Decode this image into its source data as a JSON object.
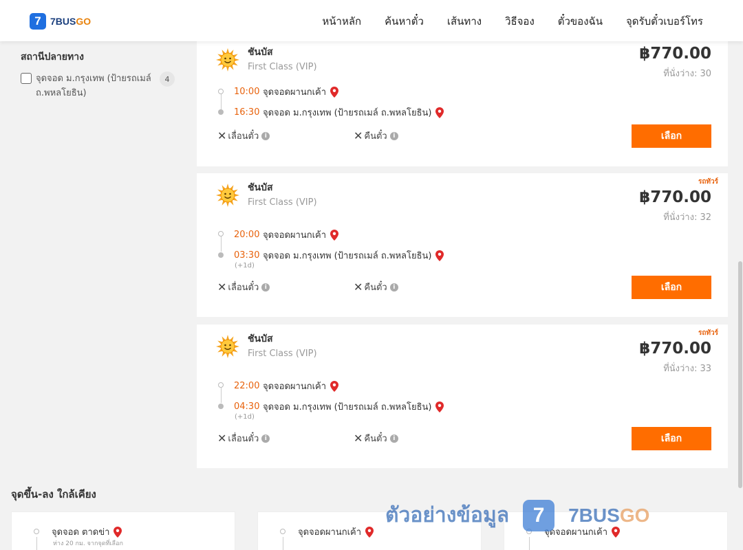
{
  "header": {
    "logo_icon": "7",
    "logo_text": "7BUS",
    "logo_text_go": "GO",
    "nav": [
      "หน้าหลัก",
      "ค้นหาตั๋ว",
      "เส้นทาง",
      "วิธีจอง",
      "ตั๋วของฉัน",
      "จุดรับตั๋วเบอร์โทร"
    ]
  },
  "sidebar": {
    "title": "สถานีปลายทาง",
    "filter_label": "จุดจอด ม.กรุงเทพ (ป้ายรถเมล์ ถ.พหลโยธิน)",
    "filter_count": "4"
  },
  "trips": [
    {
      "operator": "ชันบัส",
      "class": "First Class (VIP)",
      "price": "฿770.00",
      "seats": "ที่นั่งว่าง: 30",
      "promo": "",
      "depart_time": "10:00",
      "depart_place": "จุดจอดผานกเค้า",
      "arrive_time": "16:30",
      "arrive_place": "จุดจอด ม.กรุงเทพ (ป้ายรถเมล์ ถ.พหลโยธิน)",
      "next_day": "",
      "reschedule": "เลื่อนตั๋ว",
      "refund": "คืนตั๋ว",
      "button": "เลือก"
    },
    {
      "operator": "ชันบัส",
      "class": "First Class (VIP)",
      "price": "฿770.00",
      "seats": "ที่นั่งว่าง: 32",
      "promo": "รถทัวร์",
      "depart_time": "20:00",
      "depart_place": "จุดจอดผานกเค้า",
      "arrive_time": "03:30",
      "arrive_place": "จุดจอด ม.กรุงเทพ (ป้ายรถเมล์ ถ.พหลโยธิน)",
      "next_day": "(+1d)",
      "reschedule": "เลื่อนตั๋ว",
      "refund": "คืนตั๋ว",
      "button": "เลือก"
    },
    {
      "operator": "ชันบัส",
      "class": "First Class (VIP)",
      "price": "฿770.00",
      "seats": "ที่นั่งว่าง: 33",
      "promo": "รถทัวร์",
      "depart_time": "22:00",
      "depart_place": "จุดจอดผานกเค้า",
      "arrive_time": "04:30",
      "arrive_place": "จุดจอด ม.กรุงเทพ (ป้ายรถเมล์ ถ.พหลโยธิน)",
      "next_day": "(+1d)",
      "reschedule": "เลื่อนตั๋ว",
      "refund": "คืนตั๋ว",
      "button": "เลือก"
    }
  ],
  "nearby": {
    "title": "จุดขึ้น-ลง ใกล้เคียง",
    "cards": [
      {
        "stop": "จุดจอด ตาดข่า",
        "sub": "ห่าง 20 กม. จากจุดที่เลือก"
      },
      {
        "stop": "จุดจอดผานกเค้า",
        "sub": ""
      },
      {
        "stop": "จุดจอดผานกเค้า",
        "sub": ""
      }
    ]
  },
  "watermark": {
    "text": "ตัวอย่างข้อมูล",
    "icon": "7",
    "brand": "7BUS",
    "brand_go": "GO"
  },
  "colors": {
    "accent": "#ff6d00",
    "time": "#e8620c",
    "pin": "#e02a2a",
    "logo_blue": "#1f6fe0"
  }
}
